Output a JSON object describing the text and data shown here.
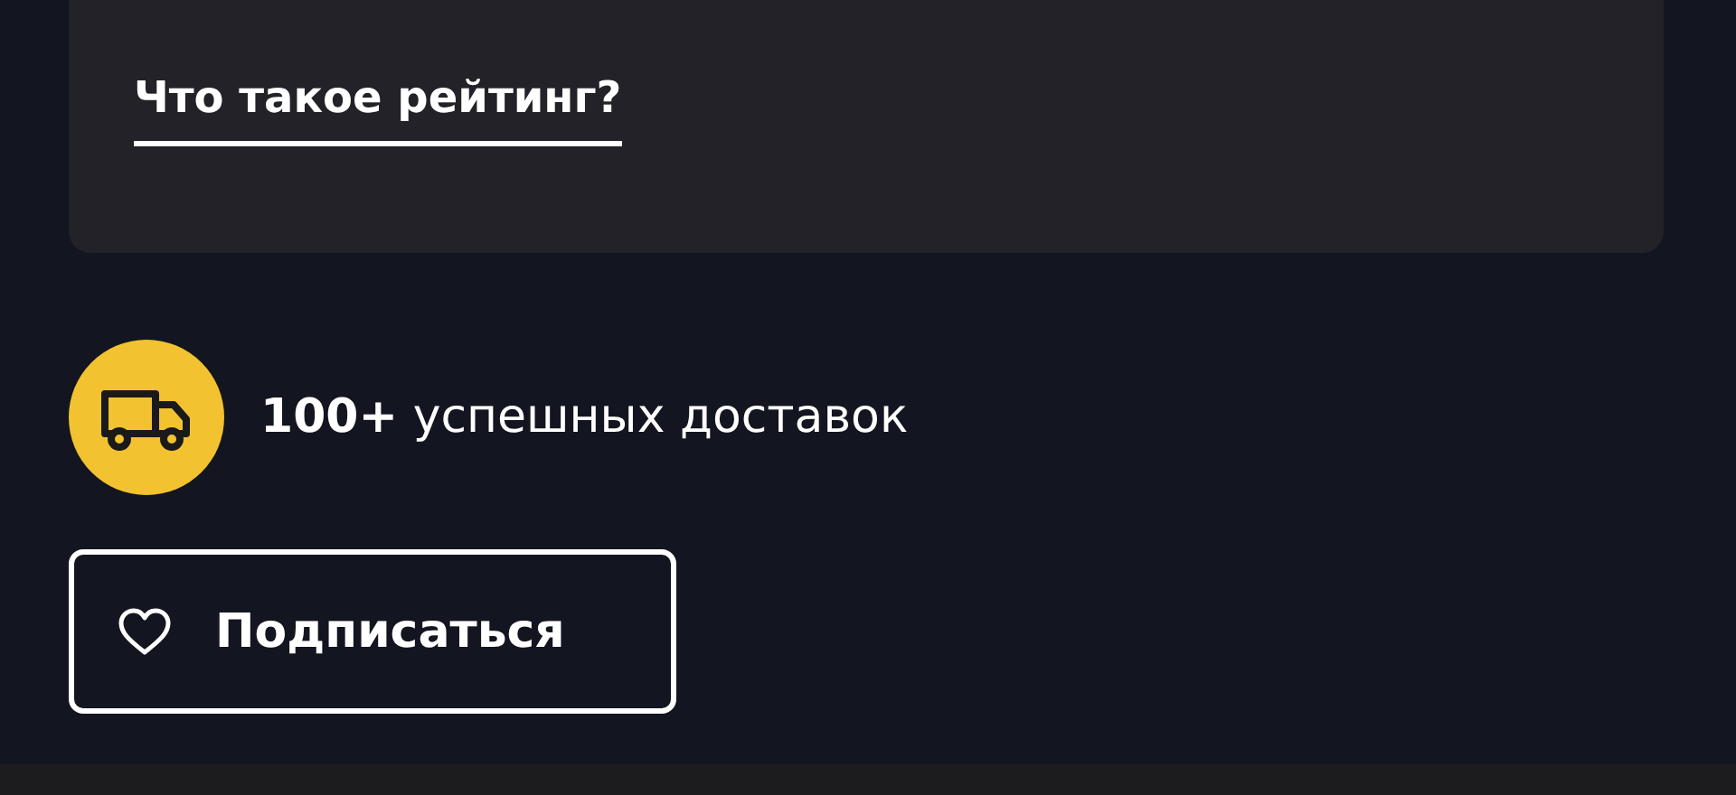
{
  "rating_card": {
    "link": "Что такое рейтинг?"
  },
  "deliveries": {
    "text": "**100+** успешных доставок"
  },
  "subscribe_button": {
    "label": "Подписаться"
  }
}
